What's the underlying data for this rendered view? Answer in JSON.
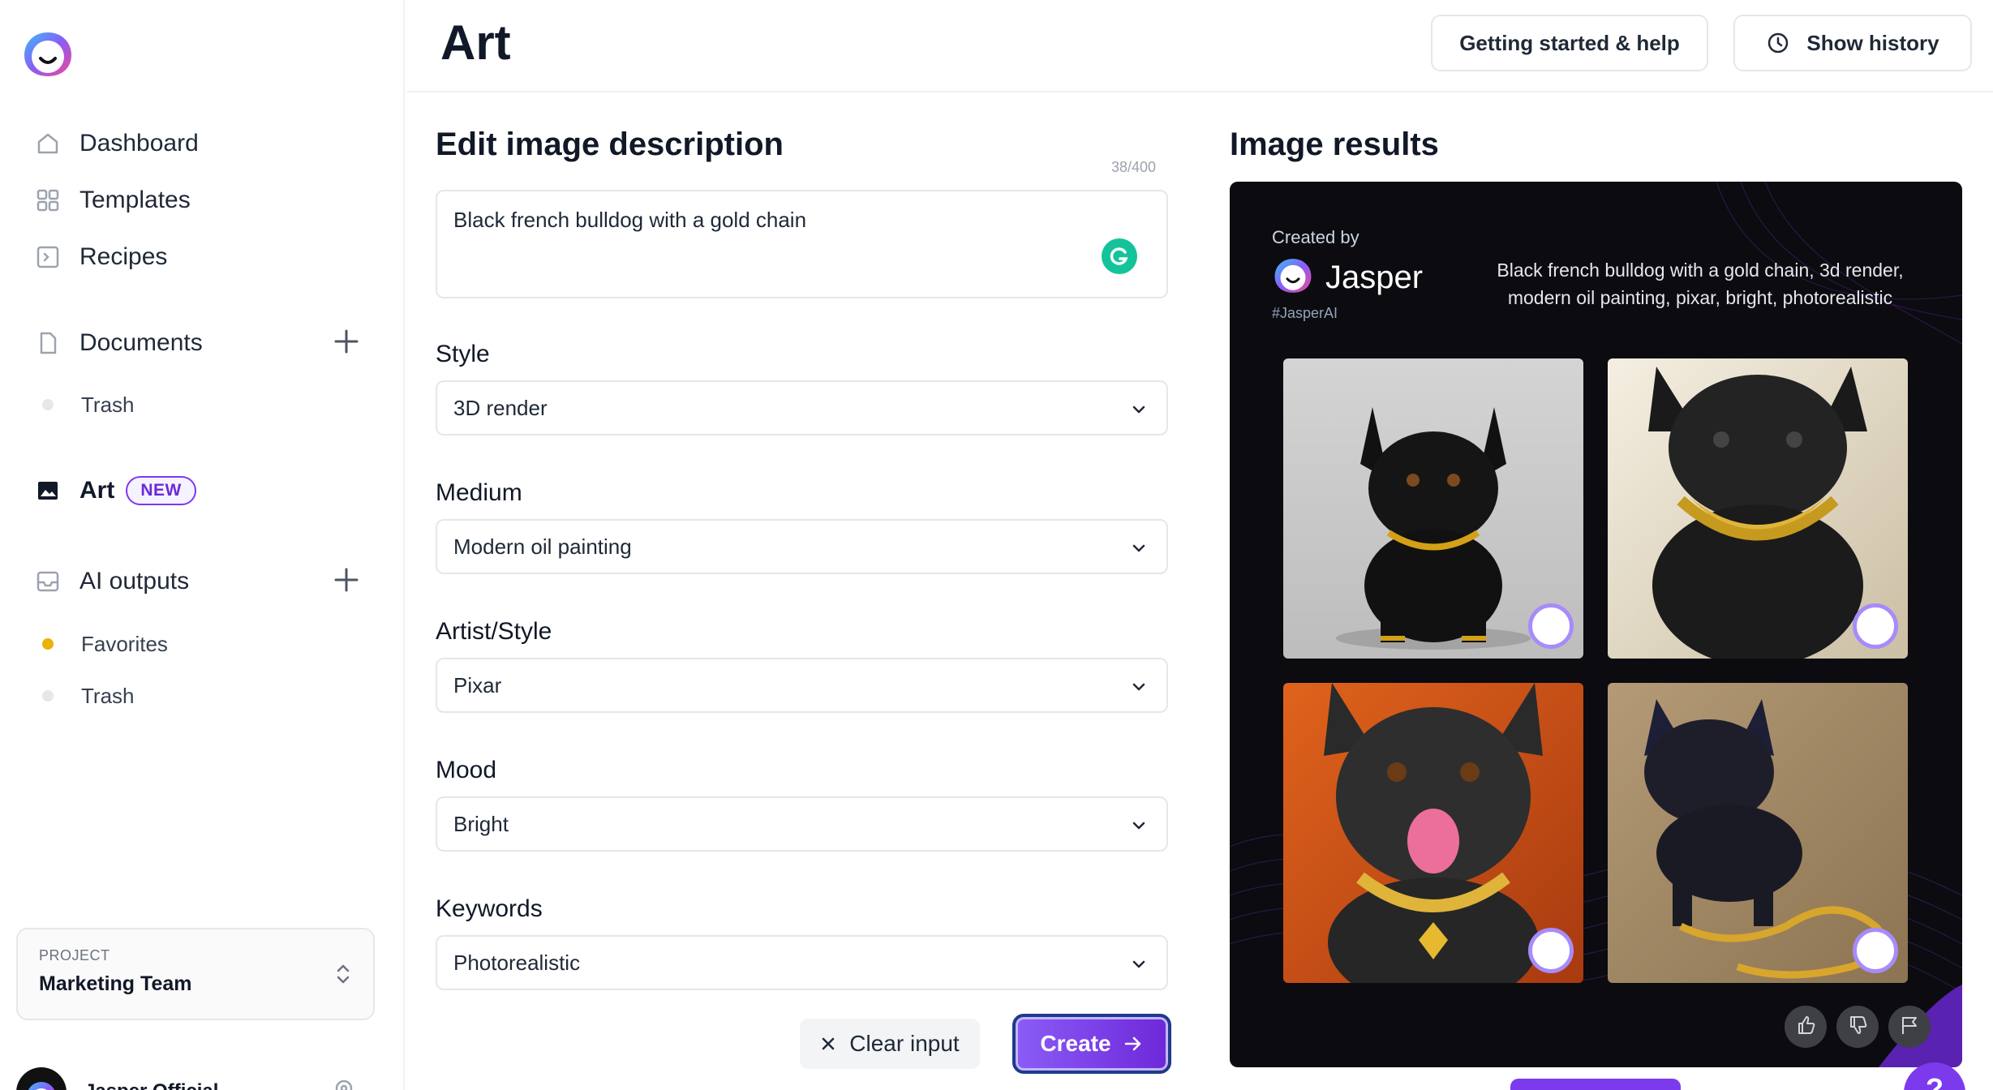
{
  "header": {
    "title": "Art",
    "help_button": "Getting started & help",
    "history_button": "Show history"
  },
  "sidebar": {
    "nav": {
      "dashboard": "Dashboard",
      "templates": "Templates",
      "recipes": "Recipes",
      "documents": "Documents",
      "documents_trash": "Trash",
      "art": "Art",
      "art_badge": "NEW",
      "ai_outputs": "AI outputs",
      "favorites": "Favorites",
      "outputs_trash": "Trash"
    },
    "project": {
      "label": "PROJECT",
      "name": "Marketing Team"
    },
    "user": {
      "name": "Jasper Official"
    }
  },
  "form": {
    "title": "Edit image description",
    "counter": "38/400",
    "description": "Black french bulldog with a gold chain",
    "fields": {
      "style": {
        "label": "Style",
        "value": "3D render"
      },
      "medium": {
        "label": "Medium",
        "value": "Modern oil painting"
      },
      "artist": {
        "label": "Artist/Style",
        "value": "Pixar"
      },
      "mood": {
        "label": "Mood",
        "value": "Bright"
      },
      "keywords": {
        "label": "Keywords",
        "value": "Photorealistic"
      }
    },
    "clear_button": "Clear input",
    "create_button": "Create"
  },
  "results": {
    "title": "Image results",
    "created_by": "Created by",
    "brand": "Jasper",
    "hashtag": "#JasperAI",
    "prompt": "Black french bulldog with a gold chain, 3d render, modern oil painting, pixar, bright, photorealistic"
  },
  "help_fab": "?",
  "colors": {
    "accent": "#7c3aed",
    "favorite_dot": "#eab308",
    "grammarly": "#15c39a",
    "results_bg": "#0b0b10"
  }
}
